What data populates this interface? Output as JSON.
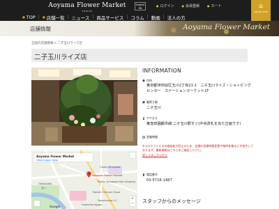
{
  "header": {
    "logo_name": "Aoyama Flower Market",
    "logo_sub": "TOKYO",
    "lang_line1": "English",
    "lang_line2": "EN",
    "util_links": [
      "ログイン",
      "会員登録",
      "カート"
    ],
    "online_store_label": "ONLINE SHOP",
    "nav": [
      "TOP",
      "店舗一覧",
      "ニュース",
      "商品サービス",
      "コラム",
      "動画",
      "法人の方"
    ]
  },
  "banner": {
    "title": "店舗情報",
    "script_text": "Aoyama Flower Market"
  },
  "breadcrumb": [
    "全国の店舗情報",
    "二子玉川ライズ店"
  ],
  "page_title": "二子玉川ライズ店",
  "info": {
    "heading": "INFORMATION",
    "address_label": "住所",
    "address_value": "東京都世田谷区玉川2丁目21-1　二子玉川ライズ・ショッピングセンター　ステーションマーケット1F",
    "station_label": "最寄り駅",
    "station_value": "二子玉川",
    "access_label": "アクセス",
    "access_value": "東急田園都市線 二子玉川駅すぐ(中央改札を出た正面です)",
    "hours_label": "営業時間",
    "notice_text": "※コロナウイルスの感染拡大防止のため、店舗の営業時間変更や臨時休業などが発生しております。最新情報はこちらをご確認ください。",
    "notice_link": "詳しくはこちらから",
    "phone_label": "電話番号",
    "phone_value": "03-5716-1487",
    "staff_heading": "スタッフからのメッセージ"
  },
  "map": {
    "card_title": "Aoyama Flower Market",
    "card_link": "View larger map",
    "pin_label": "Aoyama Flower Market",
    "labels": [
      "Futako-Tamagawa",
      "TAMAGAWA",
      "玉川",
      "Futako Tamagawa Rise Shopping",
      "Rakuten Crimson House",
      "Takashimaya S.C.",
      "Futako-Tamagawa"
    ],
    "google_label": "Google"
  },
  "colors": {
    "header_bg": "#1d1d1d",
    "accent_gold": "#d1a12a",
    "notice_red": "#d62020"
  }
}
